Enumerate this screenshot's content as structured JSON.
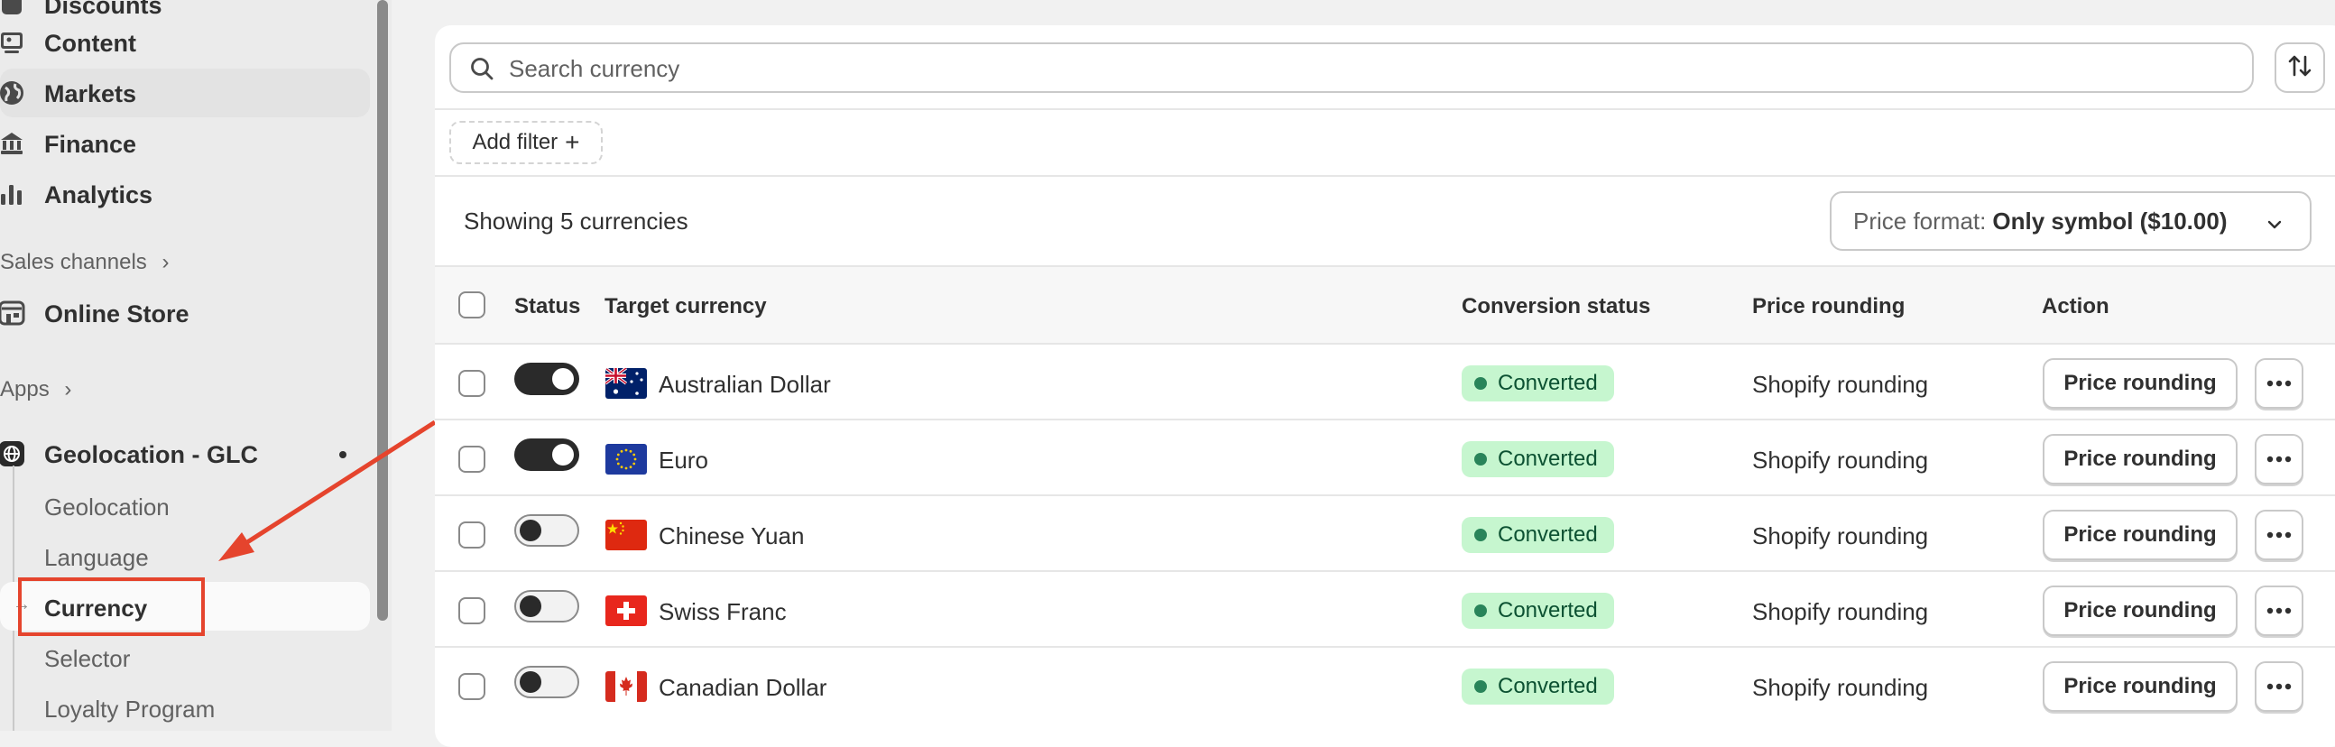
{
  "sidebar": {
    "items": [
      {
        "label": "Discounts",
        "icon": "discount-icon"
      },
      {
        "label": "Content",
        "icon": "content-icon"
      },
      {
        "label": "Markets",
        "icon": "globe-icon"
      },
      {
        "label": "Finance",
        "icon": "bank-icon"
      },
      {
        "label": "Analytics",
        "icon": "bar-chart-icon"
      }
    ],
    "sales_channels_label": "Sales channels",
    "online_store_label": "Online Store",
    "apps_label": "Apps",
    "app_name": "Geolocation - GLC",
    "app_subitems": [
      "Geolocation",
      "Language",
      "Currency",
      "Selector",
      "Loyalty Program"
    ],
    "annotation_color": "#e5442d"
  },
  "main": {
    "search_placeholder": "Search currency",
    "add_filter_label": "Add filter",
    "showing_text": "Showing 5 currencies",
    "price_format_label": "Price format:",
    "price_format_value": "Only symbol ($10.00)",
    "columns": [
      "Status",
      "Target currency",
      "Conversion status",
      "Price rounding",
      "Action"
    ],
    "rows": [
      {
        "enabled": true,
        "flag": "australia-flag-icon",
        "currency": "Australian Dollar",
        "conversion": "Converted",
        "rounding": "Shopify rounding",
        "action": "Price rounding"
      },
      {
        "enabled": true,
        "flag": "eu-flag-icon",
        "currency": "Euro",
        "conversion": "Converted",
        "rounding": "Shopify rounding",
        "action": "Price rounding"
      },
      {
        "enabled": false,
        "flag": "china-flag-icon",
        "currency": "Chinese Yuan",
        "conversion": "Converted",
        "rounding": "Shopify rounding",
        "action": "Price rounding"
      },
      {
        "enabled": false,
        "flag": "switzerland-flag-icon",
        "currency": "Swiss Franc",
        "conversion": "Converted",
        "rounding": "Shopify rounding",
        "action": "Price rounding"
      },
      {
        "enabled": false,
        "flag": "canada-flag-icon",
        "currency": "Canadian Dollar",
        "conversion": "Converted",
        "rounding": "Shopify rounding",
        "action": "Price rounding"
      }
    ],
    "badge_color": "#c6f6cf"
  }
}
